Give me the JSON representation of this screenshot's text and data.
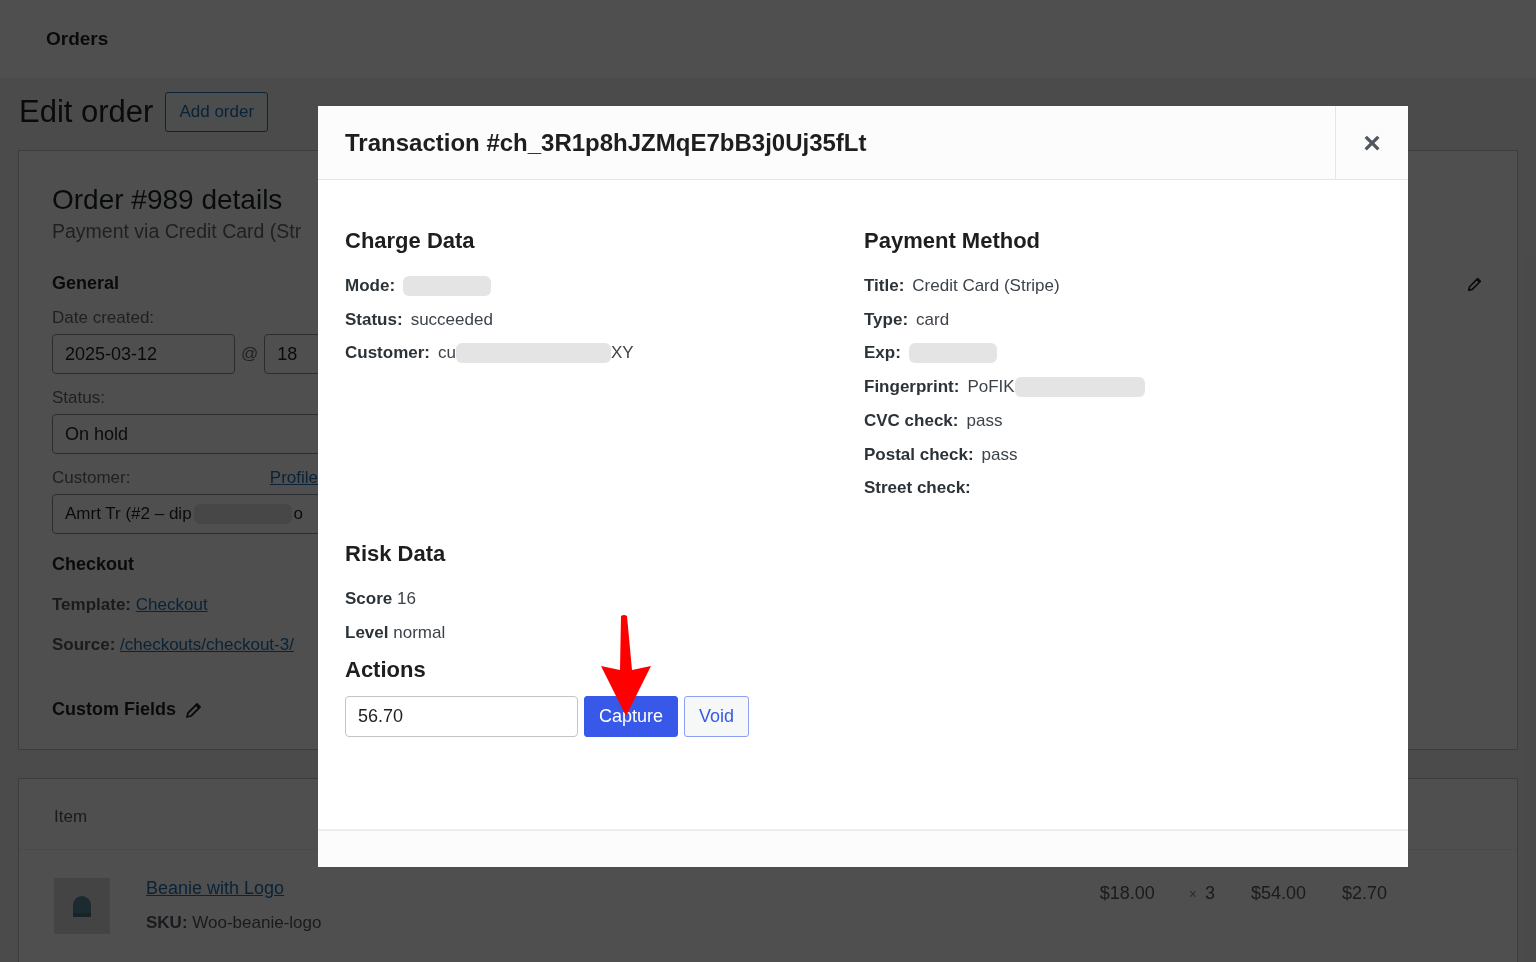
{
  "admin": {
    "page_title": "Orders",
    "heading": "Edit order",
    "add_button": "Add order"
  },
  "order": {
    "title": "Order #989 details",
    "subtitle": "Payment via Credit Card (Str",
    "general_heading": "General",
    "date_label": "Date created:",
    "date_value": "2025-03-12",
    "at": "@",
    "hour_value": "18",
    "status_label": "Status:",
    "status_value": "On hold",
    "customer_label": "Customer:",
    "profile_link": "Profile",
    "customer_parts": [
      {
        "kind": "text",
        "text": "Amrt Tr (#2 – dip"
      },
      {
        "kind": "redacted"
      },
      {
        "kind": "text",
        "text": "o"
      }
    ],
    "checkout_heading": "Checkout",
    "template_label": "Template:",
    "template_link": "Checkout",
    "source_label": "Source:",
    "source_link": "/checkouts/checkout-3/",
    "custom_fields": "Custom Fields"
  },
  "items": {
    "column_header": "Item",
    "rows": [
      {
        "name": "Beanie with Logo",
        "sku_label": "SKU:",
        "sku": "Woo-beanie-logo",
        "cost": "$18.00",
        "times": "×",
        "qty": "3",
        "total": "$54.00",
        "tax": "$2.70"
      }
    ]
  },
  "modal": {
    "title": "Transaction #ch_3R1p8hJZMqE7bB3j0Uj35fLt",
    "close": "×",
    "charge": {
      "heading": "Charge Data",
      "rows": [
        {
          "label": "Mode:",
          "parts": [
            {
              "kind": "redacted"
            }
          ]
        },
        {
          "label": "Status:",
          "parts": [
            {
              "kind": "text",
              "text": "succeeded"
            }
          ]
        },
        {
          "label": "Customer:",
          "parts": [
            {
              "kind": "text",
              "text": "cu"
            },
            {
              "kind": "redacted"
            },
            {
              "kind": "text",
              "text": "XY"
            }
          ]
        }
      ]
    },
    "payment": {
      "heading": "Payment Method",
      "rows": [
        {
          "label": "Title:",
          "parts": [
            {
              "kind": "text",
              "text": "Credit Card (Stripe)"
            }
          ]
        },
        {
          "label": "Type:",
          "parts": [
            {
              "kind": "text",
              "text": "card"
            }
          ]
        },
        {
          "label": "Exp:",
          "parts": [
            {
              "kind": "redacted"
            }
          ]
        },
        {
          "label": "Fingerprint:",
          "parts": [
            {
              "kind": "text",
              "text": "PoFIK"
            },
            {
              "kind": "redacted"
            }
          ]
        },
        {
          "label": "CVC check:",
          "parts": [
            {
              "kind": "text",
              "text": "pass"
            }
          ]
        },
        {
          "label": "Postal check:",
          "parts": [
            {
              "kind": "text",
              "text": "pass"
            }
          ]
        },
        {
          "label": "Street check:",
          "parts": []
        }
      ]
    },
    "risk": {
      "heading": "Risk Data",
      "rows": [
        {
          "label": "Score",
          "value": "16"
        },
        {
          "label": "Level",
          "value": "normal"
        }
      ]
    },
    "actions": {
      "heading": "Actions",
      "amount": "56.70",
      "buttons": [
        {
          "label": "Capture",
          "kind": "primary"
        },
        {
          "label": "Void",
          "kind": "secondary"
        }
      ]
    }
  }
}
